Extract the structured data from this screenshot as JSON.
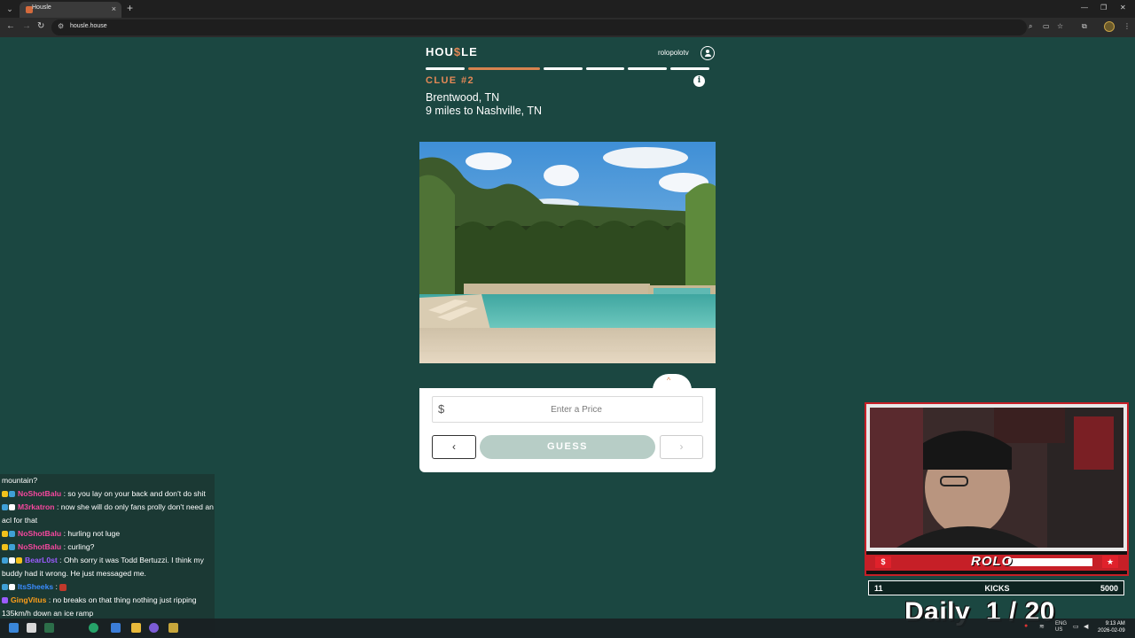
{
  "browser": {
    "tab_title": "Housle",
    "url": "housle.house",
    "tab_list_glyph": "⌄",
    "new_tab_glyph": "+",
    "close_glyph": "×",
    "back_glyph": "←",
    "forward_glyph": "→",
    "reload_glyph": "↻",
    "minimize_glyph": "—",
    "restore_glyph": "❐",
    "window_close_glyph": "✕",
    "zoom_glyph": "⌕",
    "cast_glyph": "▭",
    "bookmark_glyph": "☆",
    "extensions_glyph": "⧉",
    "menu_glyph": "⋮"
  },
  "game": {
    "logo_prefix": "HOU",
    "logo_accent": "$",
    "logo_suffix": "LE",
    "username": "rolopolotv",
    "progress": {
      "total": 6,
      "current": 2
    },
    "clue_label": "CLUE #2",
    "clue_line_1": "Brentwood, TN",
    "clue_line_2": "9 miles to Nashville, TN",
    "info_glyph": "i",
    "photo_description": "backyard pool",
    "toggle_glyph": "^",
    "currency_symbol": "$",
    "price_placeholder": "Enter a Price",
    "prev_glyph": "‹",
    "guess_label": "GUESS",
    "next_glyph": "›"
  },
  "chat": {
    "messages": [
      {
        "user": "",
        "color": "#ffffff",
        "text": "mountain?"
      },
      {
        "user": "NoShotBalu",
        "color": "#f5479e",
        "text": ": so you lay on your back and don't do shit"
      },
      {
        "user": "M3rkatron",
        "color": "#f5479e",
        "text": ": now she will do only fans prolly don't need an acl for that"
      },
      {
        "user": "NoShotBalu",
        "color": "#f5479e",
        "text": ": hurling not luge"
      },
      {
        "user": "NoShotBalu",
        "color": "#f5479e",
        "text": ": curling?"
      },
      {
        "user": "BearL0st",
        "color": "#9b5cff",
        "text": ": Ohh sorry it was Todd Bertuzzi. I think my buddy had it wrong. He just messaged me."
      },
      {
        "user": "ItsSheeks",
        "color": "#3a8cff",
        "text": ":"
      },
      {
        "user": "GingVitus",
        "color": "#ff9f1a",
        "text": ": no breaks on that thing nothing just ripping 135km/h down an ice ramp"
      }
    ]
  },
  "overlay": {
    "cam_logo": "$",
    "cam_title": "ROLO",
    "cam_star": "★",
    "kicks_left": "11",
    "kicks_label": "KICKS",
    "kicks_right": "5000",
    "daily_text": "Daily  1 / 20"
  },
  "taskbar": {
    "lang_top": "ENG",
    "lang_bottom": "US",
    "time": "9:13 AM",
    "date": "2026-02-09"
  },
  "colors": {
    "background": "#1b4741",
    "accent": "#e38856",
    "guess_disabled": "#b7cdc6"
  }
}
